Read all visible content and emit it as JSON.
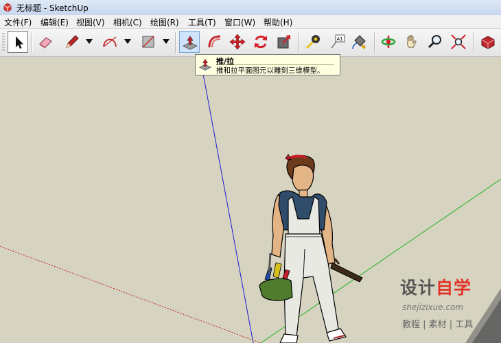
{
  "window": {
    "title": "无标题 - SketchUp",
    "app_icon": "sketchup-logo-icon"
  },
  "menu": [
    {
      "label": "文件(F)"
    },
    {
      "label": "编辑(E)"
    },
    {
      "label": "视图(V)"
    },
    {
      "label": "相机(C)"
    },
    {
      "label": "绘图(R)"
    },
    {
      "label": "工具(T)"
    },
    {
      "label": "窗口(W)"
    },
    {
      "label": "帮助(H)"
    }
  ],
  "toolbar": {
    "active_tool": "select",
    "hovered_tool": "push-pull",
    "tools": [
      "select",
      "eraser",
      "pencil",
      "arc",
      "rectangle",
      "push-pull",
      "follow-me",
      "move",
      "rotate",
      "scale",
      "tape-measure",
      "text",
      "paint-bucket",
      "orbit",
      "pan",
      "zoom",
      "zoom-extents",
      "components"
    ]
  },
  "tooltip": {
    "title": "推/拉",
    "description": "推和拉平面图元以雕刻三维模型。"
  },
  "viewport": {
    "background": "#d6d4c0",
    "axis_colors": {
      "blue": "#1a1ad0",
      "green": "#1fb01f",
      "red": "#c02020"
    }
  },
  "watermark": {
    "brand_left": "设计",
    "brand_right": "自学",
    "url": "shejizixue.com",
    "tagline": "教程 | 素材 | 工具"
  }
}
